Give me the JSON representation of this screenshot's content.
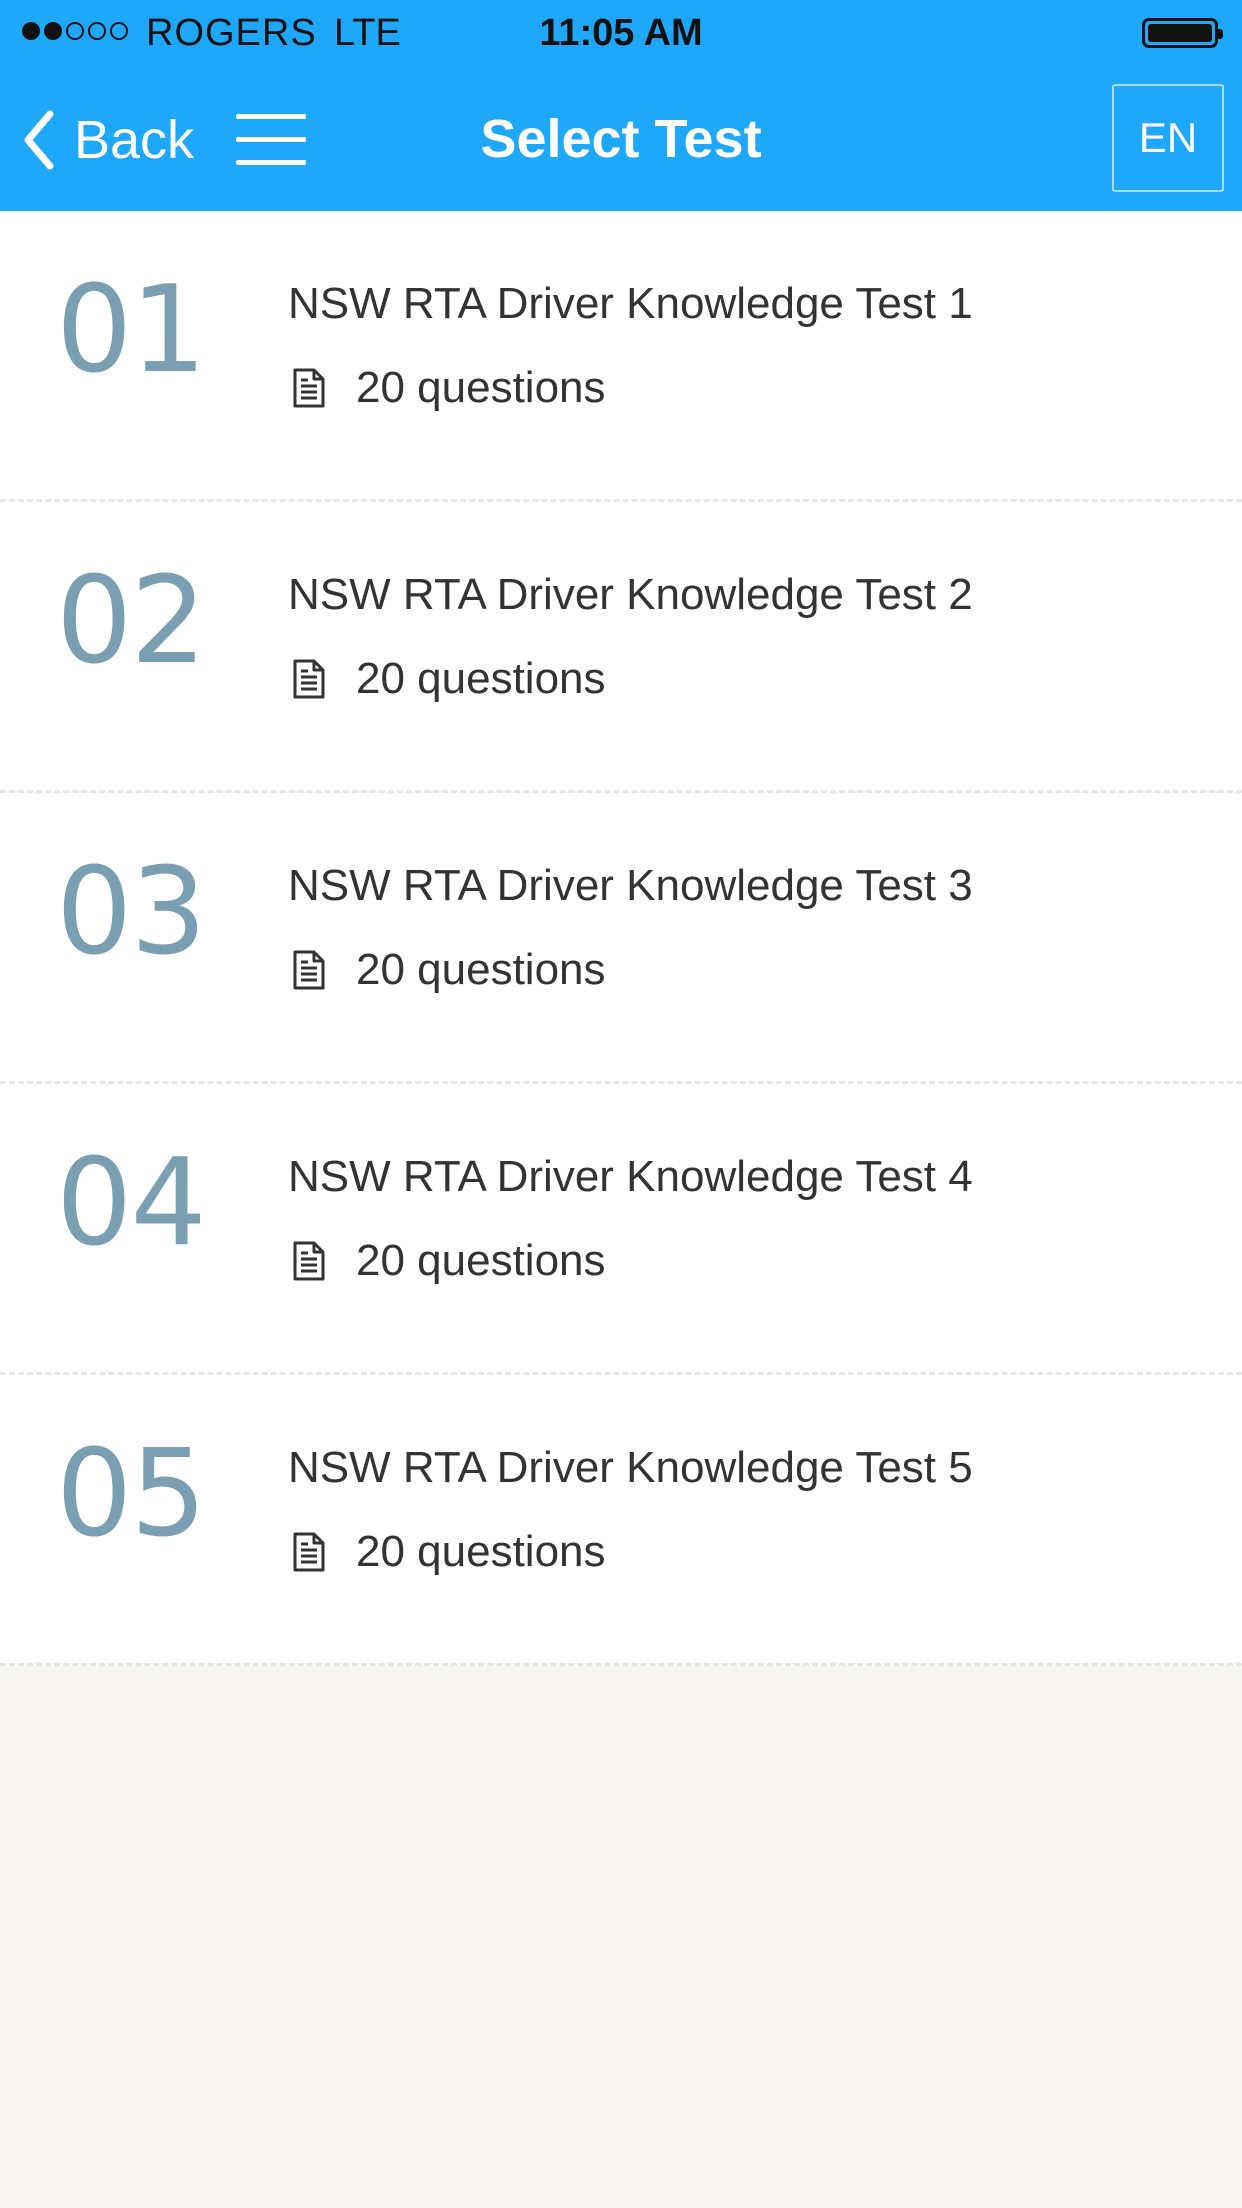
{
  "status_bar": {
    "signal": [
      true,
      true,
      false,
      false,
      false
    ],
    "carrier": "ROGERS",
    "network": "LTE",
    "time": "11:05 AM",
    "battery_level": 1.0
  },
  "nav": {
    "back_label": "Back",
    "title": "Select Test",
    "language": "EN"
  },
  "colors": {
    "header_bg": "#1da8fb",
    "number_color": "#7a9fb3",
    "page_bg": "#f7f6f5"
  },
  "icons": {
    "back": "chevron-left-icon",
    "menu": "hamburger-menu-icon",
    "questions": "document-icon"
  },
  "tests": [
    {
      "number": "01",
      "title": "NSW RTA Driver Knowledge Test 1",
      "questions": "20 questions"
    },
    {
      "number": "02",
      "title": "NSW RTA Driver Knowledge Test 2",
      "questions": "20 questions"
    },
    {
      "number": "03",
      "title": "NSW RTA Driver Knowledge Test 3",
      "questions": "20 questions"
    },
    {
      "number": "04",
      "title": "NSW RTA Driver Knowledge Test 4",
      "questions": "20 questions"
    },
    {
      "number": "05",
      "title": "NSW RTA Driver Knowledge Test 5",
      "questions": "20 questions"
    }
  ]
}
